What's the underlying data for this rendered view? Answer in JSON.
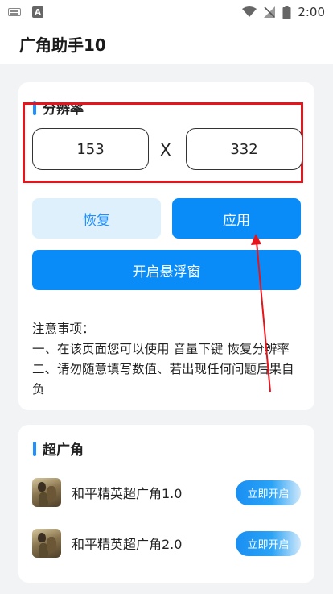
{
  "status_bar": {
    "time": "2:00",
    "keyboard_icon": "keyboard-icon",
    "a_badge": "A",
    "icons": [
      "wifi-icon",
      "signal-off-icon",
      "battery-icon"
    ]
  },
  "app": {
    "title": "广角助手10"
  },
  "resolution": {
    "section_title": "分辨率",
    "width_value": "153",
    "separator": "X",
    "height_value": "332"
  },
  "buttons": {
    "restore": "恢复",
    "apply": "应用",
    "open_float": "开启悬浮窗"
  },
  "notes": {
    "heading": "注意事项：",
    "line1": "一、在该页面您可以使用 音量下键 恢复分辨率",
    "line2": "二、请勿随意填写数值、若出现任何问题后果自负"
  },
  "wide_angle": {
    "section_title": "超广角",
    "games": [
      {
        "name": "和平精英超广角1.0",
        "button": "立即开启"
      },
      {
        "name": "和平精英超广角2.0",
        "button": "立即开启"
      }
    ]
  },
  "colors": {
    "primary": "#0a8cf8",
    "light_primary": "#dff0fd",
    "annotation_red": "#e8141b"
  }
}
